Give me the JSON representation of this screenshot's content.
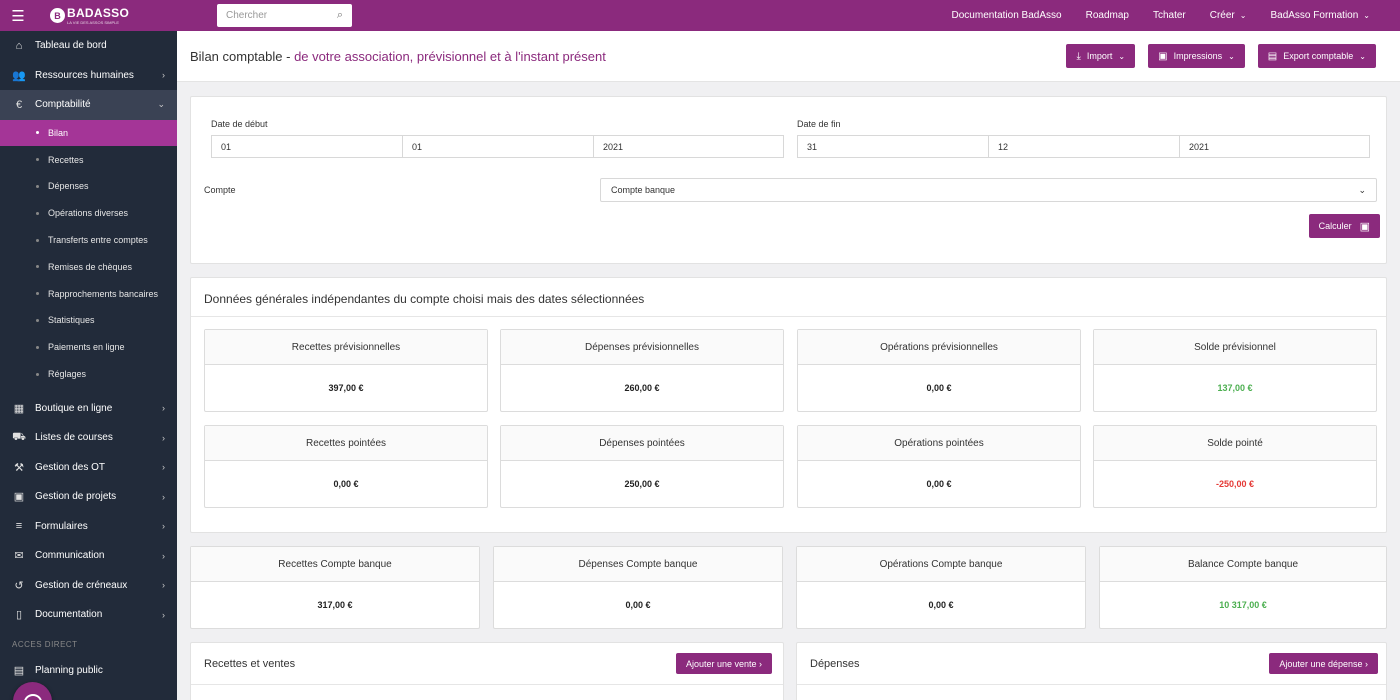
{
  "topbar": {
    "logo": "BADASSO",
    "logo_sub": "LA VIE DES ASSOS SIMPLE",
    "search_placeholder": "Chercher",
    "nav": [
      {
        "label": "Documentation BadAsso"
      },
      {
        "label": "Roadmap"
      },
      {
        "label": "Tchater"
      },
      {
        "label": "Créer"
      },
      {
        "label": "BadAsso Formation"
      }
    ]
  },
  "sidebar": {
    "items_top": [
      {
        "label": "Tableau de bord"
      },
      {
        "label": "Ressources humaines"
      },
      {
        "label": "Comptabilité"
      }
    ],
    "sub_items": [
      {
        "label": "Bilan"
      },
      {
        "label": "Recettes"
      },
      {
        "label": "Dépenses"
      },
      {
        "label": "Opérations diverses"
      },
      {
        "label": "Transferts entre comptes"
      },
      {
        "label": "Remises de chèques"
      },
      {
        "label": "Rapprochements bancaires"
      },
      {
        "label": "Statistiques"
      },
      {
        "label": "Paiements en ligne"
      },
      {
        "label": "Réglages"
      }
    ],
    "items_bottom": [
      {
        "label": "Boutique en ligne"
      },
      {
        "label": "Listes de courses"
      },
      {
        "label": "Gestion des OT"
      },
      {
        "label": "Gestion de projets"
      },
      {
        "label": "Formulaires"
      },
      {
        "label": "Communication"
      },
      {
        "label": "Gestion de créneaux"
      },
      {
        "label": "Documentation"
      }
    ],
    "section_label": "ACCES DIRECT",
    "last_item": "Planning public"
  },
  "header": {
    "title": "Bilan comptable - ",
    "subtitle": "de votre association, prévisionnel et à l'instant présent",
    "import_label": "Import",
    "impressions_label": "Impressions",
    "export_label": "Export comptable"
  },
  "form": {
    "start_label": "Date de début",
    "start_day": "01",
    "start_month": "01",
    "start_year": "2021",
    "end_label": "Date de fin",
    "end_day": "31",
    "end_month": "12",
    "end_year": "2021",
    "account_label": "Compte",
    "account_value": "Compte banque",
    "calc_label": "Calculer"
  },
  "general": {
    "title": "Données générales indépendantes du compte choisi mais des dates sélectionnées",
    "stats": [
      {
        "label": "Recettes prévisionnelles",
        "value": "397,00 €"
      },
      {
        "label": "Dépenses prévisionnelles",
        "value": "260,00 €"
      },
      {
        "label": "Opérations prévisionnelles",
        "value": "0,00 €"
      },
      {
        "label": "Solde prévisionnel",
        "value": "137,00 €"
      },
      {
        "label": "Recettes pointées",
        "value": "0,00 €"
      },
      {
        "label": "Dépenses pointées",
        "value": "250,00 €"
      },
      {
        "label": "Opérations pointées",
        "value": "0,00 €"
      },
      {
        "label": "Solde pointé",
        "value": "-250,00 €"
      }
    ]
  },
  "account_stats": [
    {
      "label": "Recettes Compte banque",
      "value": "317,00 €"
    },
    {
      "label": "Dépenses Compte banque",
      "value": "0,00 €"
    },
    {
      "label": "Opérations Compte banque",
      "value": "0,00 €"
    },
    {
      "label": "Balance Compte banque",
      "value": "10 317,00 €"
    }
  ],
  "lists": {
    "recettes_title": "Recettes et ventes",
    "recettes_button": "Ajouter une vente ›",
    "depenses_title": "Dépenses",
    "depenses_button": "Ajouter une dépense ›"
  },
  "colors": {
    "brand": "#8b2a7d",
    "sidebar": "#222b3a",
    "positive": "#4caf50",
    "negative": "#e53935"
  }
}
